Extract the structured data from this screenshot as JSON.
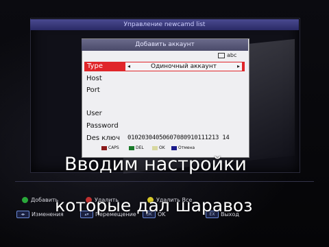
{
  "screen": {
    "title": "Управление newcamd list"
  },
  "dialog": {
    "title": "Добавить аккаунт",
    "input_mode": "abc",
    "fields": {
      "type_label": "Type",
      "type_value": "Одиночный аккаунт",
      "host_label": "Host",
      "port_label": "Port",
      "user_label": "User",
      "password_label": "Password",
      "des_label": "Des ключ",
      "des_value": "01020304050607080910111213 14"
    },
    "keys": [
      {
        "label": "CAPS",
        "color": "#8a1a1a"
      },
      {
        "label": "DEL",
        "color": "#1a7a2a"
      },
      {
        "label": "OK",
        "color": "#d8d8a0"
      },
      {
        "label": "Отмена",
        "color": "#1a1a8a"
      }
    ]
  },
  "footer": {
    "add": "Добавить",
    "delete": "Удалить",
    "delete_all": "Удалить Все",
    "edit": "Изменения",
    "move": "Перемещение",
    "ok": "OK",
    "exit": "Выход"
  },
  "overlay": {
    "line1": "Вводим настройки",
    "line2": "которые дал шаравоз"
  },
  "colors": {
    "green_button": "#2aa83a",
    "red_button": "#c03030",
    "yellow_button": "#d8c82a",
    "selected_row": "#e0262a"
  }
}
